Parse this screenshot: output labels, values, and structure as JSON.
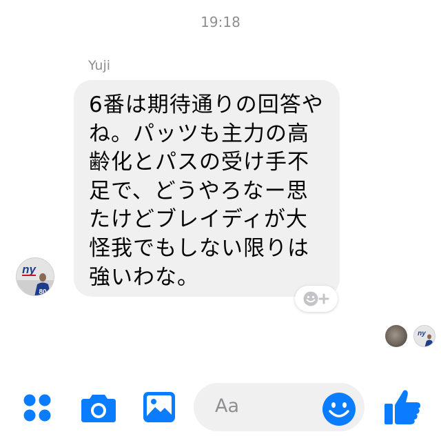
{
  "conversation": {
    "timestamp": "19:18",
    "sender_name": "Yuji",
    "message": {
      "lines": [
        "6番は期待通りの回答や",
        "ね。パッツも主力の高",
        "齢化とパスの受け手不",
        "足で、どうやろなー思",
        "たけどブレイディが大",
        "怪我でもしない限りは",
        "強いわな。"
      ]
    },
    "reaction_button": {
      "icon": "smiley-plus-icon"
    },
    "sender_avatar": {
      "logo_text": "ny",
      "jersey_number": "80"
    },
    "seen_by": [
      {
        "icon": "user-avatar"
      },
      {
        "icon": "user-avatar",
        "logo_text": "ny"
      }
    ]
  },
  "composer": {
    "input_placeholder": "Aa",
    "icons": [
      "apps-icon",
      "camera-icon",
      "gallery-icon",
      "emoji-icon",
      "thumbs-up-icon"
    ]
  },
  "colors": {
    "accent": "#0a7cff",
    "bubble_bg": "#f0f0f1",
    "meta_text": "#8e8e93",
    "giants_blue": "#1f3d8a",
    "giants_red": "#c8102e"
  }
}
